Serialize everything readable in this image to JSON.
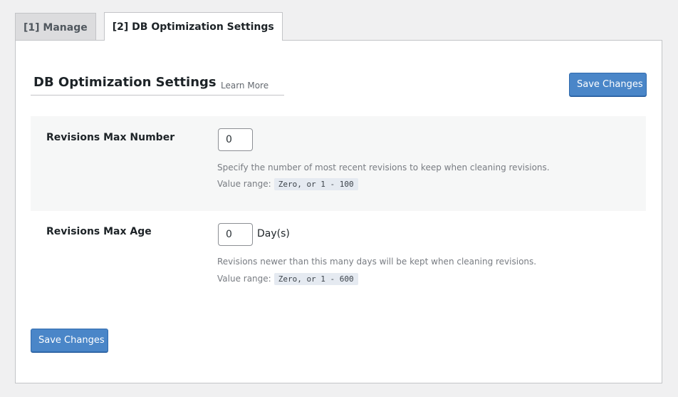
{
  "tabs": [
    {
      "label": "[1] Manage",
      "active": false
    },
    {
      "label": "[2] DB Optimization Settings",
      "active": true
    }
  ],
  "section": {
    "title": "DB Optimization Settings",
    "learn_more": "Learn More"
  },
  "buttons": {
    "save_top": "Save Changes",
    "save_bottom": "Save Changes"
  },
  "settings": [
    {
      "label": "Revisions Max Number",
      "value": "0",
      "unit": "",
      "description": "Specify the number of most recent revisions to keep when cleaning revisions.",
      "range_label": "Value range:",
      "range_value": "Zero, or 1 - 100"
    },
    {
      "label": "Revisions Max Age",
      "value": "0",
      "unit": "Day(s)",
      "description": "Revisions newer than this many days will be kept when cleaning revisions.",
      "range_label": "Value range:",
      "range_value": "Zero, or 1 - 600"
    }
  ],
  "colors": {
    "primary_button": "#4a86c8",
    "row_alt_background": "#f6f7f7",
    "page_background": "#f0f0f1"
  }
}
